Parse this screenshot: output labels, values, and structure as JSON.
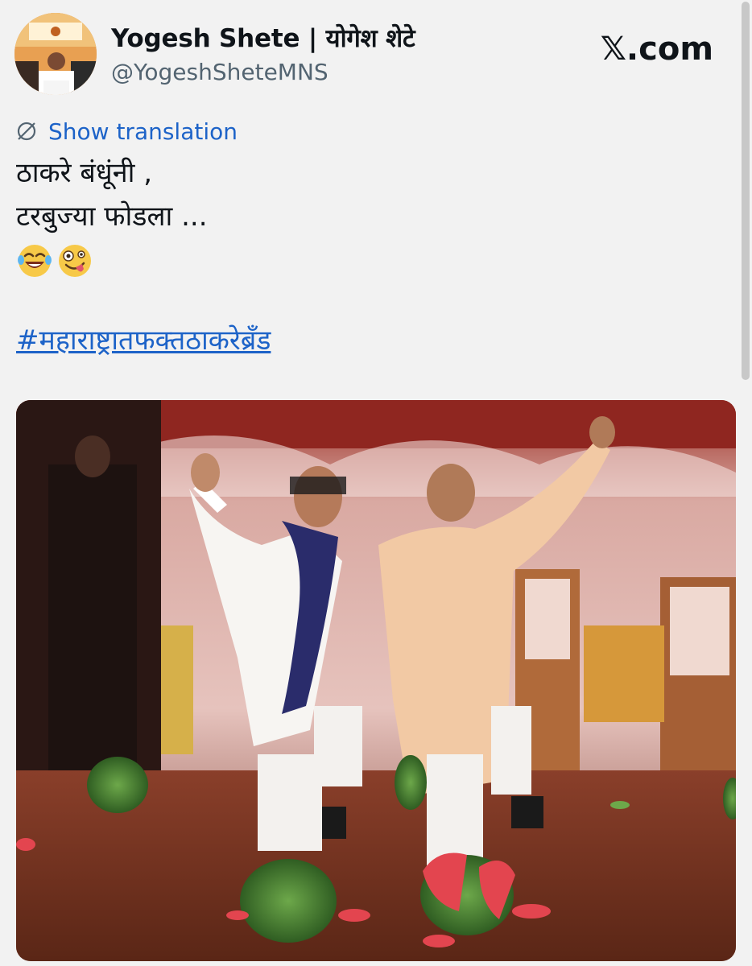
{
  "author": {
    "display_name": "Yogesh Shete | योगेश शेटे",
    "handle": "@YogeshSheteMNS",
    "avatar_icon": "profile-photo"
  },
  "brand": {
    "label": "𝕏.com"
  },
  "translation": {
    "label": "Show translation",
    "icon": "globe-slash-icon"
  },
  "tweet": {
    "lines": [
      "ठाकरे बंधूंनी ,",
      "टरबुज्या फोडला ..."
    ],
    "emojis": [
      "face-with-tears-of-joy",
      "zany-face"
    ],
    "hashtag": "#महाराष्ट्रातफक्तठाकरेब्रँड"
  },
  "media": {
    "type": "photo"
  },
  "colors": {
    "link": "#1d63c8",
    "secondary_text": "#536471",
    "background": "#f2f2f2"
  }
}
